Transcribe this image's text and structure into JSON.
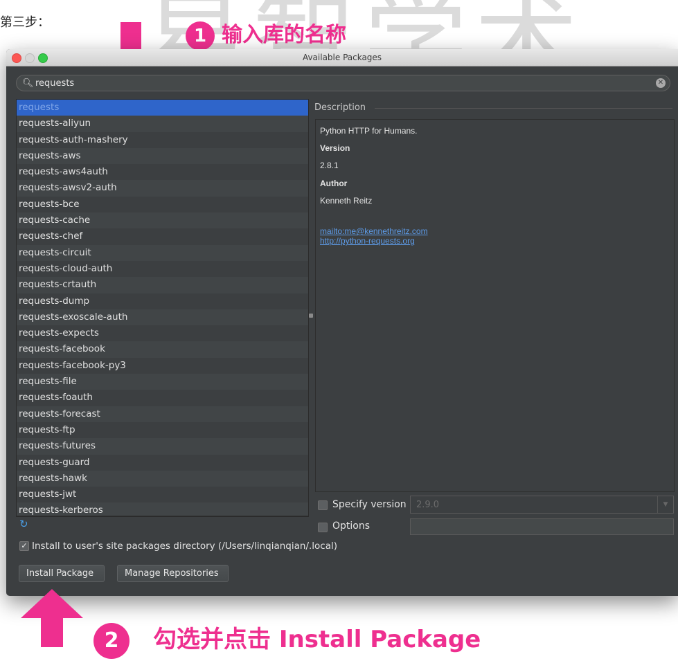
{
  "page": {
    "step_label": "第三步：",
    "watermark": "易智学术"
  },
  "annotations": {
    "step1_number": "1",
    "step1_text": "输入库的名称",
    "step2_number": "2",
    "step2_text": "勾选并点击 Install Package",
    "color": "#ee2f8f"
  },
  "window": {
    "title": "Available Packages"
  },
  "search": {
    "value": "requests"
  },
  "packages": [
    "requests",
    "requests-aliyun",
    "requests-auth-mashery",
    "requests-aws",
    "requests-aws4auth",
    "requests-awsv2-auth",
    "requests-bce",
    "requests-cache",
    "requests-chef",
    "requests-circuit",
    "requests-cloud-auth",
    "requests-crtauth",
    "requests-dump",
    "requests-exoscale-auth",
    "requests-expects",
    "requests-facebook",
    "requests-facebook-py3",
    "requests-file",
    "requests-foauth",
    "requests-forecast",
    "requests-ftp",
    "requests-futures",
    "requests-guard",
    "requests-hawk",
    "requests-jwt",
    "requests-kerberos"
  ],
  "selected_package": "requests",
  "description": {
    "header": "Description",
    "summary": "Python HTTP for Humans.",
    "version_label": "Version",
    "version": "2.8.1",
    "author_label": "Author",
    "author": "Kenneth Reitz",
    "email_link": "mailto:me@kennethreitz.com",
    "homepage_link": "http://python-requests.org"
  },
  "options": {
    "specify_version_label": "Specify version",
    "specify_version_value": "2.9.0",
    "options_label": "Options"
  },
  "install_to_user": {
    "checked": true,
    "label": "Install to user's site packages directory (/Users/linqianqian/.local)"
  },
  "buttons": {
    "install": "Install Package",
    "manage": "Manage Repositories"
  },
  "icons": {
    "search": "search-icon",
    "clear": "clear-search-icon",
    "refresh": "refresh-icon",
    "arrow_down": "arrow-down-icon",
    "arrow_up": "arrow-up-icon"
  }
}
